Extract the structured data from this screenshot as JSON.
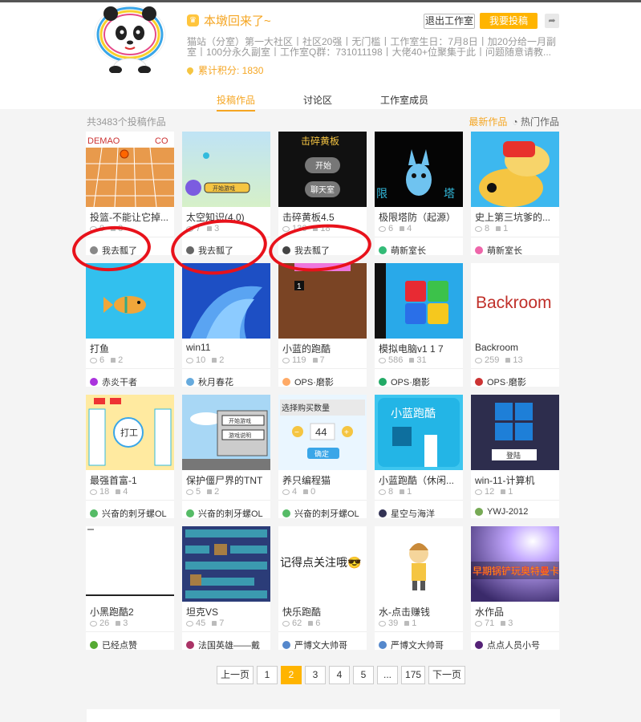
{
  "header": {
    "title": "本墩回来了~",
    "exit_label": "退出工作室",
    "submit_label": "我要投稿",
    "share_icon": "share-icon",
    "description": "猫站（分室）第一大社区丨社区20强丨无门槛丨工作室生日：7月8日丨加20分给一月副室丨100分永久副室丨工作室Q群：731011198丨大佬40+位聚集于此丨问题随意请教...",
    "points": "累计积分: 1830",
    "accent_color": "#f5a623"
  },
  "tabs": [
    {
      "label": "投稿作品",
      "active": true
    },
    {
      "label": "讨论区",
      "active": false
    },
    {
      "label": "工作室成员",
      "active": false
    }
  ],
  "works_count": "共3483个投稿作品",
  "sort": {
    "newest": "最新作品",
    "hot": "热门作品"
  },
  "cards": [
    {
      "name": "投篮-不能让它掉...",
      "views": "0",
      "likes": "3",
      "author": "我去瓢了",
      "thumb": "basketball",
      "thumb_text": "DEMAO"
    },
    {
      "name": "太空知识(4.0)",
      "views": "7",
      "likes": "3",
      "author": "我去瓢了",
      "thumb": "space",
      "thumb_text": "开始游戏"
    },
    {
      "name": "击碎黄板4.5",
      "views": "136",
      "likes": "18",
      "author": "我去瓢了",
      "thumb": "breakboard",
      "thumb_text": "击碎黄板",
      "thumb_btn1": "开始",
      "thumb_btn2": "聊天室"
    },
    {
      "name": "极限塔防（起源）",
      "views": "6",
      "likes": "4",
      "author": "萌新室长",
      "thumb": "tower",
      "thumb_text": "限塔"
    },
    {
      "name": "史上第三坑爹的...",
      "views": "8",
      "likes": "1",
      "author": "萌新室长",
      "thumb": "cartoon",
      "thumb_text": ""
    },
    {
      "name": "打鱼",
      "views": "6",
      "likes": "2",
      "author": "赤炎干者",
      "thumb": "fish",
      "thumb_text": ""
    },
    {
      "name": "win11",
      "views": "10",
      "likes": "2",
      "author": "秋月春花",
      "thumb": "win11",
      "thumb_text": ""
    },
    {
      "name": "小蓝的跑酷",
      "views": "119",
      "likes": "7",
      "author": "OPS·磨影",
      "thumb": "brownbox",
      "thumb_text": "1"
    },
    {
      "name": "模拟电脑v1 1 7",
      "views": "586",
      "likes": "31",
      "author": "OPS·磨影",
      "thumb": "tiles",
      "thumb_text": ""
    },
    {
      "name": "Backroom",
      "views": "259",
      "likes": "13",
      "author": "OPS·磨影",
      "thumb": "backroom",
      "thumb_text": "Backroom"
    },
    {
      "name": "最强首富-1",
      "views": "18",
      "likes": "4",
      "author": "兴奋的刺牙螺OL",
      "thumb": "richest",
      "thumb_text": "打工"
    },
    {
      "name": "保护僵尸界的TNT",
      "views": "5",
      "likes": "2",
      "author": "兴奋的刺牙螺OL",
      "thumb": "tnt",
      "thumb_text": "开始游戏",
      "thumb_btn2": "游戏说明"
    },
    {
      "name": "养只编程猫",
      "views": "4",
      "likes": "0",
      "author": "兴奋的刺牙螺OL",
      "thumb": "buycount",
      "thumb_text": "选择购买数量",
      "thumb_num": "44",
      "thumb_btn1": "确定"
    },
    {
      "name": "小蓝跑酷（休闲...",
      "views": "8",
      "likes": "1",
      "author": "星空与海洋",
      "thumb": "bluerun",
      "thumb_text": "小蓝跑酷"
    },
    {
      "name": "win-11-计算机",
      "views": "12",
      "likes": "1",
      "author": "YWJ-2012",
      "thumb": "winlogin",
      "thumb_text": "登陆"
    },
    {
      "name": "小黑跑酷2",
      "views": "26",
      "likes": "3",
      "author": "已经点赞",
      "thumb": "blank",
      "thumb_text": ""
    },
    {
      "name": "坦克VS",
      "views": "45",
      "likes": "7",
      "author": "法国英雄——戴",
      "thumb": "tank",
      "thumb_text": ""
    },
    {
      "name": "快乐跑酷",
      "views": "62",
      "likes": "6",
      "author": "严博文大帅哥",
      "thumb": "follow",
      "thumb_text": "记得点关注哦😎"
    },
    {
      "name": "水-点击赚钱",
      "views": "39",
      "likes": "1",
      "author": "严博文大帅哥",
      "thumb": "character",
      "thumb_text": ""
    },
    {
      "name": "水作品",
      "views": "71",
      "likes": "3",
      "author": "点点人员小号",
      "thumb": "ultraman",
      "thumb_text": "早期锅铲玩奥特曼卡"
    }
  ],
  "pagination": {
    "prev": "上一页",
    "pages": [
      "1",
      "2",
      "3",
      "4",
      "5",
      "...",
      "175"
    ],
    "current": "2",
    "next": "下一页"
  }
}
